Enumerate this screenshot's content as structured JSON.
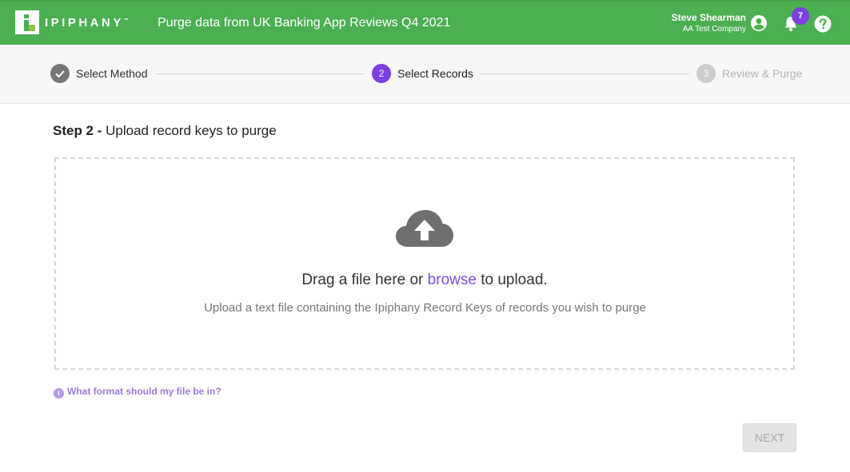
{
  "header": {
    "brand": "IPIPHANY",
    "brand_mark": "™",
    "title": "Purge data from UK Banking App Reviews Q4 2021",
    "user_name": "Steve Shearman",
    "company": "AA Test Company",
    "notification_count": "7",
    "colors": {
      "bar": "#4caf50",
      "badge": "#7b3fe4"
    }
  },
  "stepper": {
    "steps": [
      {
        "number": "",
        "label": "Select Method",
        "state": "complete"
      },
      {
        "number": "2",
        "label": "Select Records",
        "state": "active"
      },
      {
        "number": "3",
        "label": "Review & Purge",
        "state": "pending"
      }
    ],
    "colors": {
      "complete": "#777777",
      "active": "#7b3fe4",
      "pending": "#cccccc"
    }
  },
  "main": {
    "step_prefix": "Step 2 -",
    "step_title": "Upload record keys to purge",
    "upload": {
      "icon": "cloud-upload-icon",
      "text_before": "Drag a file here or ",
      "browse_link": "browse",
      "text_after": " to upload.",
      "hint": "Upload a text file containing the Ipiphany Record Keys of records you wish to purge"
    },
    "help_link": "What format should my file be in?",
    "next_button": "NEXT"
  }
}
